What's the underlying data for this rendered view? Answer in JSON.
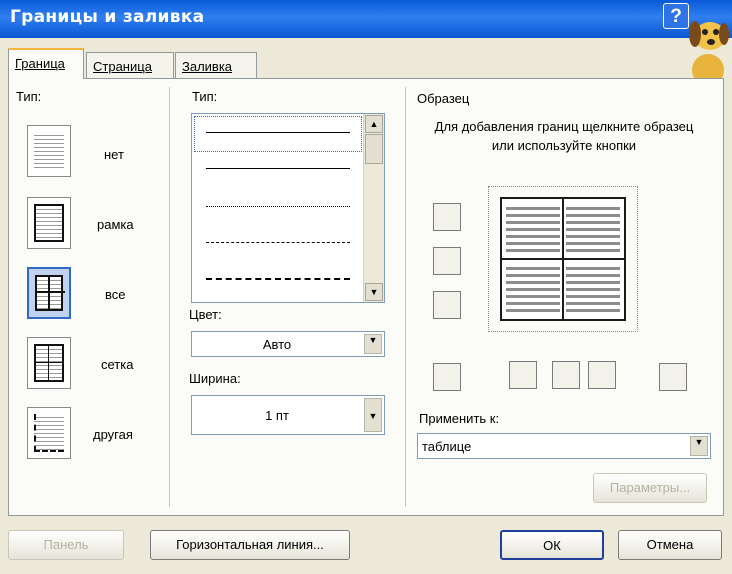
{
  "window": {
    "title": "Границы и заливка",
    "help_label": "?"
  },
  "tabs": [
    {
      "label": "Граница",
      "active": true
    },
    {
      "label": "Страница",
      "active": false
    },
    {
      "label": "Заливка",
      "active": false
    }
  ],
  "type_section": {
    "label": "Тип:",
    "options": [
      {
        "label": "нет",
        "icon": "none-border-icon",
        "selected": false
      },
      {
        "label": "рамка",
        "icon": "box-border-icon",
        "selected": false
      },
      {
        "label": "все",
        "icon": "all-borders-icon",
        "selected": true
      },
      {
        "label": "сетка",
        "icon": "grid-border-icon",
        "selected": false
      },
      {
        "label": "другая",
        "icon": "custom-border-icon",
        "selected": false
      }
    ]
  },
  "style_section": {
    "label": "Тип:",
    "line_styles": [
      "solid-thin",
      "solid",
      "dashed-fine",
      "dashed",
      "dash-dot"
    ],
    "color_label": "Цвет:",
    "color_value": "Авто",
    "width_label": "Ширина:",
    "width_value": "1 пт"
  },
  "preview_section": {
    "label": "Образец",
    "hint": "Для добавления границ щелкните образец или используйте кнопки",
    "apply_label": "Применить к:",
    "apply_value": "таблице",
    "params_label": "Параметры..."
  },
  "footer": {
    "panel_label": "Панель",
    "hline_label": "Горизонтальная линия...",
    "ok_label": "ОК",
    "cancel_label": "Отмена"
  },
  "colors": {
    "titlebar": "#0a5ad8",
    "dialog_bg": "#ece9d8",
    "tab_accent": "#f6b33b",
    "selection": "#316ac5"
  }
}
